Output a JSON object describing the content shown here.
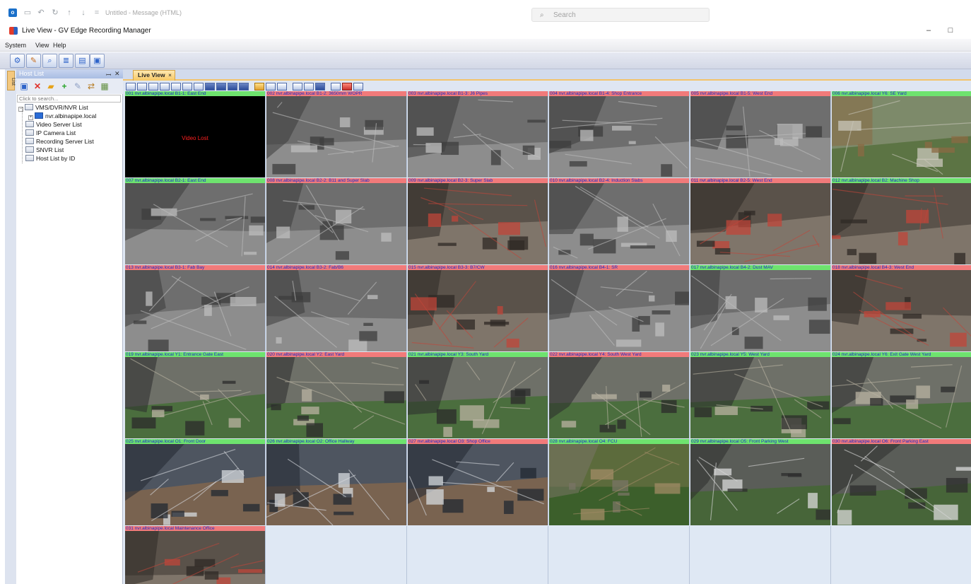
{
  "outlook": {
    "title": "Untitled - Message (HTML)",
    "search_placeholder": "Search"
  },
  "app": {
    "title": "Live View - GV Edge Recording Manager"
  },
  "menu": [
    "System",
    "View",
    "Help"
  ],
  "host_pane": {
    "strip_label": "Host List",
    "title": "Host List",
    "search_placeholder": "Click to search...",
    "tree": [
      {
        "label": "VMS/DVR/NVR List",
        "level": 0
      },
      {
        "label": "nvr.albinapipe.local",
        "level": 1
      },
      {
        "label": "Video Server List",
        "level": 0
      },
      {
        "label": "IP Camera List",
        "level": 0
      },
      {
        "label": "Recording Server List",
        "level": 0
      },
      {
        "label": "SNVR List",
        "level": 0
      },
      {
        "label": "Host List by ID",
        "level": 0
      }
    ]
  },
  "tab": {
    "label": "Live View",
    "close": "×"
  },
  "video_lost_text": "Video Lost",
  "cameras": [
    {
      "label": "001  nvr.albinapipe.local B1-1: East End",
      "status": "ok",
      "tone": "dark"
    },
    {
      "label": "002  nvr.albinapipe.local B1-2: 3650mm WOPR",
      "status": "alert",
      "tone": "gray"
    },
    {
      "label": "003  nvr.albinapipe.local B1-3: J6 Pipes",
      "status": "alert",
      "tone": "gray"
    },
    {
      "label": "004  nvr.albinapipe.local B1-4: Shop Entrance",
      "status": "alert",
      "tone": "gray"
    },
    {
      "label": "005  nvr.albinapipe.local B1-5: West End",
      "status": "alert",
      "tone": "gray"
    },
    {
      "label": "006  nvr.albinapipe.local Y6: SE Yard",
      "status": "ok",
      "tone": "yard"
    },
    {
      "label": "007  nvr.albinapipe.local B2-1: East End",
      "status": "ok",
      "tone": "gray"
    },
    {
      "label": "008  nvr.albinapipe.local B2-2: B11 and Super Slab",
      "status": "alert",
      "tone": "gray"
    },
    {
      "label": "009  nvr.albinapipe.local B2-3: Super Slab",
      "status": "alert",
      "tone": "color"
    },
    {
      "label": "010  nvr.albinapipe.local B2-4: Induction Slabs",
      "status": "alert",
      "tone": "gray"
    },
    {
      "label": "011  nvr.albinapipe.local B2-5: West End",
      "status": "alert",
      "tone": "color"
    },
    {
      "label": "012  nvr.albinapipe.local B2: Machine Shop",
      "status": "ok",
      "tone": "color"
    },
    {
      "label": "013  nvr.albinapipe.local B3-1: Fab Bay",
      "status": "alert",
      "tone": "gray"
    },
    {
      "label": "014  nvr.albinapipe.local B3-2: Fab/B6",
      "status": "alert",
      "tone": "gray"
    },
    {
      "label": "015  nvr.albinapipe.local B3-3: B7/CW",
      "status": "alert",
      "tone": "color"
    },
    {
      "label": "016  nvr.albinapipe.local B4-1: SR",
      "status": "alert",
      "tone": "gray"
    },
    {
      "label": "017  nvr.albinapipe.local B4-2: Dust MAV",
      "status": "ok",
      "tone": "gray"
    },
    {
      "label": "018  nvr.albinapipe.local B4-3: West End",
      "status": "alert",
      "tone": "color"
    },
    {
      "label": "019  nvr.albinapipe.local Y1: Entrance Gate East",
      "status": "ok",
      "tone": "outdoor"
    },
    {
      "label": "020  nvr.albinapipe.local Y2: East Yard",
      "status": "alert",
      "tone": "outdoor"
    },
    {
      "label": "021  nvr.albinapipe.local Y3: South Yard",
      "status": "ok",
      "tone": "outdoor"
    },
    {
      "label": "022  nvr.albinapipe.local Y4: South West Yard",
      "status": "alert",
      "tone": "outdoor"
    },
    {
      "label": "023  nvr.albinapipe.local Y5: West Yard",
      "status": "ok",
      "tone": "outdoor"
    },
    {
      "label": "024  nvr.albinapipe.local Y6: Exit Gate West Yard",
      "status": "ok",
      "tone": "outdoor"
    },
    {
      "label": "025  nvr.albinapipe.local O1: Front Door",
      "status": "ok",
      "tone": "office"
    },
    {
      "label": "026  nvr.albinapipe.local O2: Office Hallway",
      "status": "ok",
      "tone": "office"
    },
    {
      "label": "027  nvr.albinapipe.local O3: Shop Office",
      "status": "alert",
      "tone": "office"
    },
    {
      "label": "028  nvr.albinapipe.local O4: FCU",
      "status": "ok",
      "tone": "garden"
    },
    {
      "label": "029  nvr.albinapipe.local O5: Front Parking West",
      "status": "ok",
      "tone": "parking"
    },
    {
      "label": "030  nvr.albinapipe.local O6: Front Parking East",
      "status": "alert",
      "tone": "parking"
    },
    {
      "label": "031  nvr.albinapipe.local Maintenance Office",
      "status": "alert",
      "tone": "color"
    }
  ]
}
